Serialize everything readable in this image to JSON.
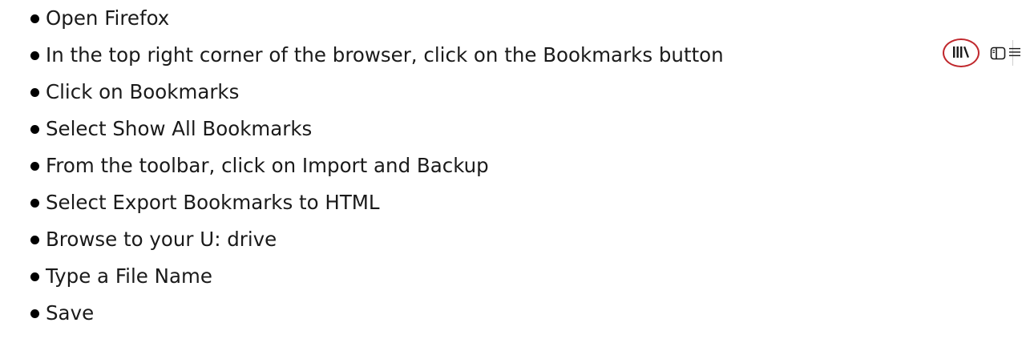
{
  "steps": [
    {
      "text": "Open Firefox"
    },
    {
      "text": "In the top right corner of the browser, click on the Bookmarks button"
    },
    {
      "text": "Click on Bookmarks"
    },
    {
      "text": "Select Show All Bookmarks"
    },
    {
      "text": "From the toolbar, click on Import and Backup"
    },
    {
      "text": "Select Export Bookmarks to HTML"
    },
    {
      "text": "Browse to your U: drive"
    },
    {
      "text": "Type a File Name"
    },
    {
      "text": "Save"
    }
  ],
  "toolbar_snippet": {
    "icons": [
      "library-icon",
      "sidebar-icon",
      "hamburger-menu-icon"
    ],
    "highlight_color": "#c0282d"
  }
}
